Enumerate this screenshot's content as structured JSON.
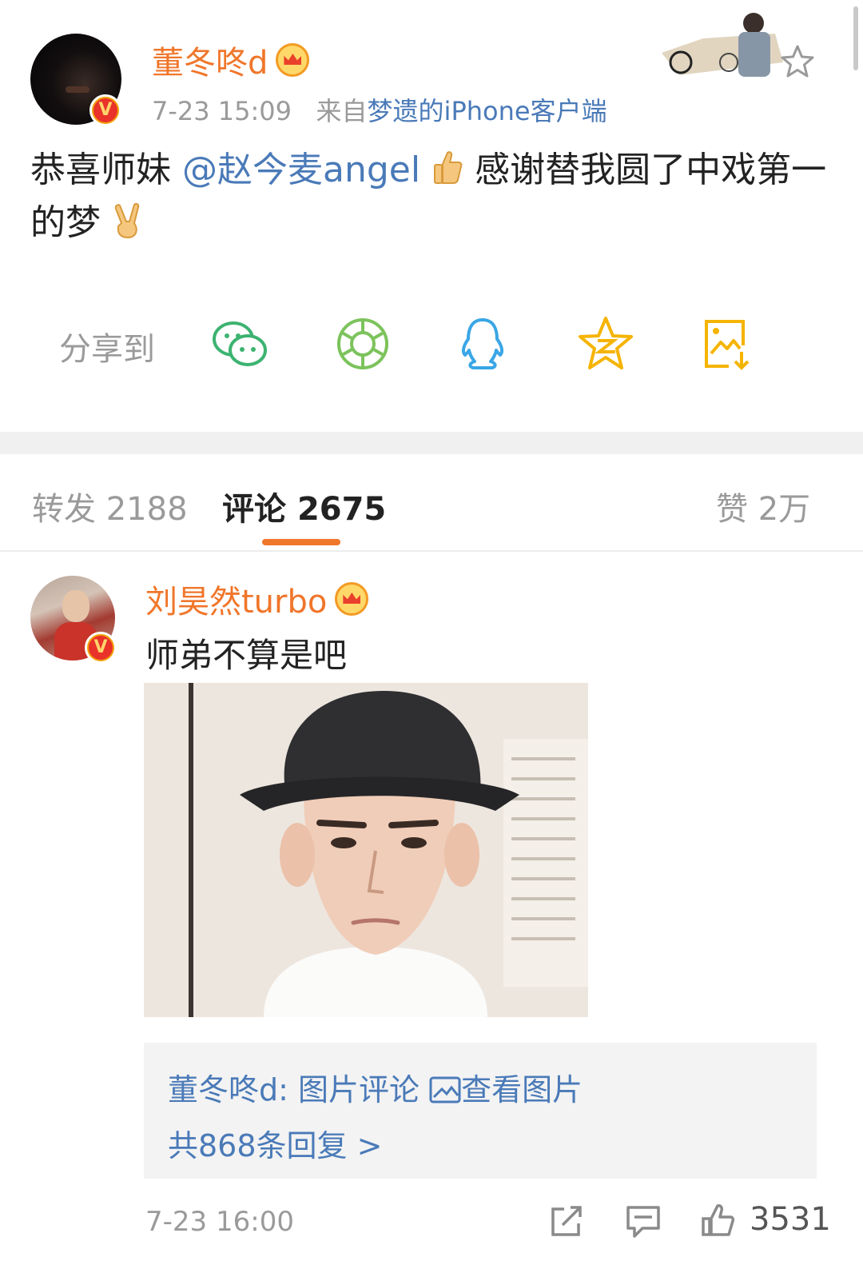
{
  "post": {
    "author": "董冬咚d",
    "time": "7-23 15:09",
    "source_prefix": "来自",
    "source_client": "梦遗的iPhone客户端",
    "text_before": "恭喜师妹",
    "mention": "@赵今麦angel",
    "text_middle": "感谢替我圆了中戏第一的梦",
    "verified_badge": "V"
  },
  "share": {
    "label": "分享到",
    "targets": [
      "wechat-icon",
      "moments-icon",
      "qq-icon",
      "qzone-icon",
      "save-image-icon"
    ]
  },
  "tabs": {
    "repost_label": "转发",
    "repost_count": "2188",
    "comment_label": "评论",
    "comment_count": "2675",
    "like_label": "赞",
    "like_count": "2万"
  },
  "comment": {
    "author": "刘昊然turbo",
    "text": "师弟不算是吧",
    "verified_badge": "V",
    "reply_author": "董冬咚d:",
    "reply_text": "图片评论",
    "reply_link": "查看图片",
    "reply_more": "共868条回复 >",
    "time": "7-23 16:00",
    "like_count": "3531"
  },
  "colors": {
    "accent": "#f0762a",
    "link": "#4a7ab8",
    "muted": "#9a9a9a"
  }
}
